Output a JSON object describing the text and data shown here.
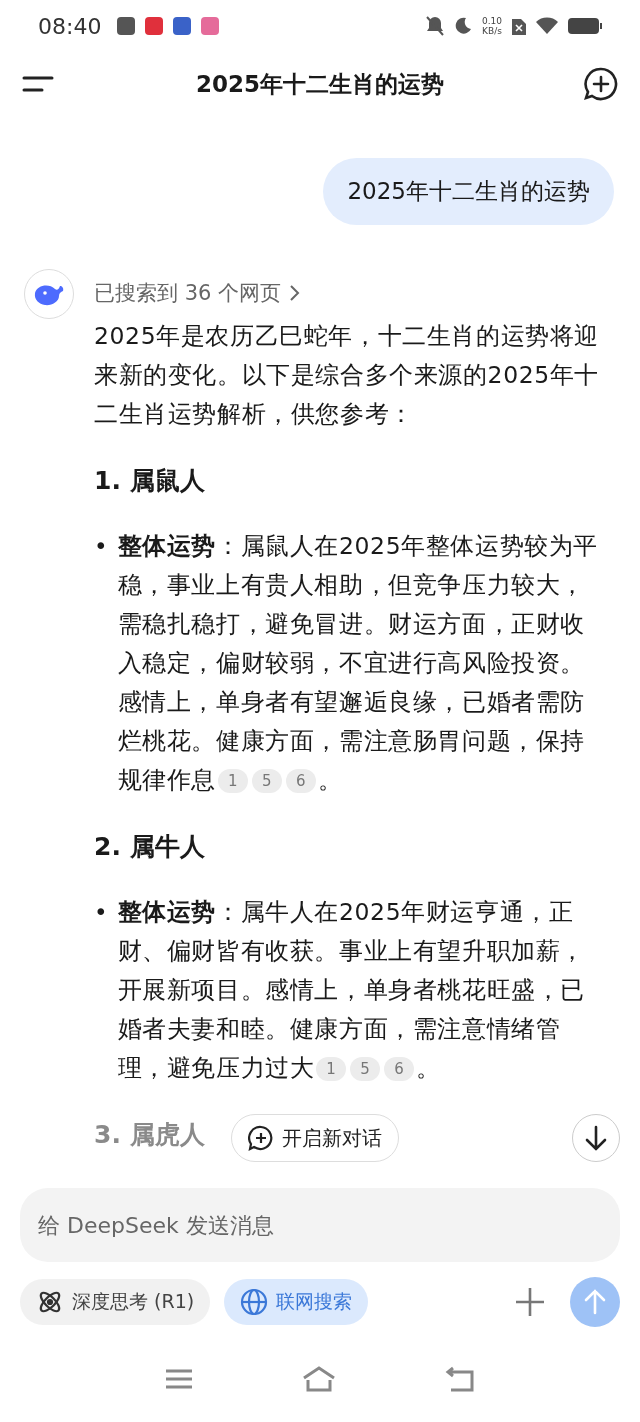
{
  "status_bar": {
    "time": "08:40",
    "net_speed": "0.10",
    "net_unit": "KB/s"
  },
  "header": {
    "title": "2025年十二生肖的运势"
  },
  "user_message": "2025年十二生肖的运势",
  "answer": {
    "search_summary": "已搜索到 36 个网页",
    "intro": "2025年是农历乙巳蛇年，十二生肖的运势将迎来新的变化。以下是综合多个来源的2025年十二生肖运势解析，供您参考：",
    "sections": [
      {
        "heading": "1. 属鼠人",
        "faded": false,
        "bullets": [
          {
            "marker": "•",
            "text": "**整体运势**：属鼠人在2025年整体运势较为平稳，事业上有贵人相助，但竞争压力较大，需稳扎稳打，避免冒进。财运方面，正财收入稳定，偏财较弱，不宜进行高风险投资。感情上，单身者有望邂逅良缘，已婚者需防烂桃花。健康方面，需注意肠胃问题，保持规律作息",
            "citations": [
              "1",
              "5",
              "6"
            ],
            "end": "。"
          }
        ]
      },
      {
        "heading": "2. 属牛人",
        "faded": false,
        "bullets": [
          {
            "marker": "•",
            "text": "**整体运势**：属牛人在2025年财运亨通，正财、偏财皆有收获。事业上有望升职加薪，开展新项目。感情上，单身者桃花旺盛，已婚者夫妻和睦。健康方面，需注意情绪管理，避免压力过大",
            "citations": [
              "1",
              "5",
              "6"
            ],
            "end": "。"
          }
        ]
      },
      {
        "heading": "3. 属虎人",
        "faded": true
      }
    ]
  },
  "new_chat_button": "开启新对话",
  "input": {
    "placeholder": "给 DeepSeek 发送消息"
  },
  "toggles": [
    {
      "kind": "think",
      "label": "深度思考 (R1)",
      "selected": false
    },
    {
      "kind": "search",
      "label": "联网搜索",
      "selected": true
    }
  ]
}
